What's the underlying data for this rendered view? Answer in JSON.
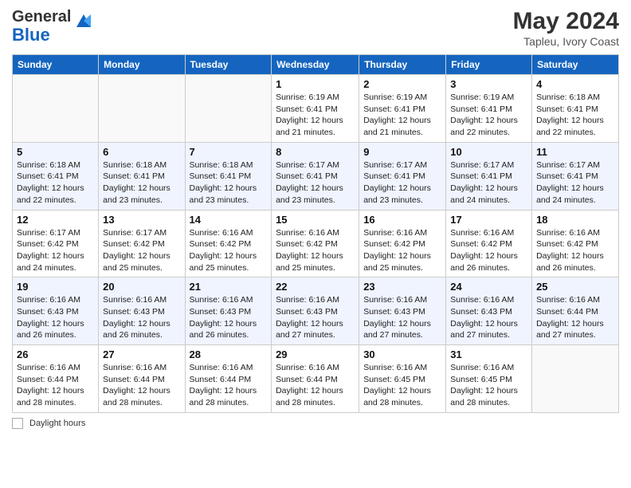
{
  "header": {
    "logo_general": "General",
    "logo_blue": "Blue",
    "month_year": "May 2024",
    "location": "Tapleu, Ivory Coast"
  },
  "weekdays": [
    "Sunday",
    "Monday",
    "Tuesday",
    "Wednesday",
    "Thursday",
    "Friday",
    "Saturday"
  ],
  "weeks": [
    [
      {
        "day": "",
        "info": ""
      },
      {
        "day": "",
        "info": ""
      },
      {
        "day": "",
        "info": ""
      },
      {
        "day": "1",
        "info": "Sunrise: 6:19 AM\nSunset: 6:41 PM\nDaylight: 12 hours and 21 minutes."
      },
      {
        "day": "2",
        "info": "Sunrise: 6:19 AM\nSunset: 6:41 PM\nDaylight: 12 hours and 21 minutes."
      },
      {
        "day": "3",
        "info": "Sunrise: 6:19 AM\nSunset: 6:41 PM\nDaylight: 12 hours and 22 minutes."
      },
      {
        "day": "4",
        "info": "Sunrise: 6:18 AM\nSunset: 6:41 PM\nDaylight: 12 hours and 22 minutes."
      }
    ],
    [
      {
        "day": "5",
        "info": "Sunrise: 6:18 AM\nSunset: 6:41 PM\nDaylight: 12 hours and 22 minutes."
      },
      {
        "day": "6",
        "info": "Sunrise: 6:18 AM\nSunset: 6:41 PM\nDaylight: 12 hours and 23 minutes."
      },
      {
        "day": "7",
        "info": "Sunrise: 6:18 AM\nSunset: 6:41 PM\nDaylight: 12 hours and 23 minutes."
      },
      {
        "day": "8",
        "info": "Sunrise: 6:17 AM\nSunset: 6:41 PM\nDaylight: 12 hours and 23 minutes."
      },
      {
        "day": "9",
        "info": "Sunrise: 6:17 AM\nSunset: 6:41 PM\nDaylight: 12 hours and 23 minutes."
      },
      {
        "day": "10",
        "info": "Sunrise: 6:17 AM\nSunset: 6:41 PM\nDaylight: 12 hours and 24 minutes."
      },
      {
        "day": "11",
        "info": "Sunrise: 6:17 AM\nSunset: 6:41 PM\nDaylight: 12 hours and 24 minutes."
      }
    ],
    [
      {
        "day": "12",
        "info": "Sunrise: 6:17 AM\nSunset: 6:42 PM\nDaylight: 12 hours and 24 minutes."
      },
      {
        "day": "13",
        "info": "Sunrise: 6:17 AM\nSunset: 6:42 PM\nDaylight: 12 hours and 25 minutes."
      },
      {
        "day": "14",
        "info": "Sunrise: 6:16 AM\nSunset: 6:42 PM\nDaylight: 12 hours and 25 minutes."
      },
      {
        "day": "15",
        "info": "Sunrise: 6:16 AM\nSunset: 6:42 PM\nDaylight: 12 hours and 25 minutes."
      },
      {
        "day": "16",
        "info": "Sunrise: 6:16 AM\nSunset: 6:42 PM\nDaylight: 12 hours and 25 minutes."
      },
      {
        "day": "17",
        "info": "Sunrise: 6:16 AM\nSunset: 6:42 PM\nDaylight: 12 hours and 26 minutes."
      },
      {
        "day": "18",
        "info": "Sunrise: 6:16 AM\nSunset: 6:42 PM\nDaylight: 12 hours and 26 minutes."
      }
    ],
    [
      {
        "day": "19",
        "info": "Sunrise: 6:16 AM\nSunset: 6:43 PM\nDaylight: 12 hours and 26 minutes."
      },
      {
        "day": "20",
        "info": "Sunrise: 6:16 AM\nSunset: 6:43 PM\nDaylight: 12 hours and 26 minutes."
      },
      {
        "day": "21",
        "info": "Sunrise: 6:16 AM\nSunset: 6:43 PM\nDaylight: 12 hours and 26 minutes."
      },
      {
        "day": "22",
        "info": "Sunrise: 6:16 AM\nSunset: 6:43 PM\nDaylight: 12 hours and 27 minutes."
      },
      {
        "day": "23",
        "info": "Sunrise: 6:16 AM\nSunset: 6:43 PM\nDaylight: 12 hours and 27 minutes."
      },
      {
        "day": "24",
        "info": "Sunrise: 6:16 AM\nSunset: 6:43 PM\nDaylight: 12 hours and 27 minutes."
      },
      {
        "day": "25",
        "info": "Sunrise: 6:16 AM\nSunset: 6:44 PM\nDaylight: 12 hours and 27 minutes."
      }
    ],
    [
      {
        "day": "26",
        "info": "Sunrise: 6:16 AM\nSunset: 6:44 PM\nDaylight: 12 hours and 28 minutes."
      },
      {
        "day": "27",
        "info": "Sunrise: 6:16 AM\nSunset: 6:44 PM\nDaylight: 12 hours and 28 minutes."
      },
      {
        "day": "28",
        "info": "Sunrise: 6:16 AM\nSunset: 6:44 PM\nDaylight: 12 hours and 28 minutes."
      },
      {
        "day": "29",
        "info": "Sunrise: 6:16 AM\nSunset: 6:44 PM\nDaylight: 12 hours and 28 minutes."
      },
      {
        "day": "30",
        "info": "Sunrise: 6:16 AM\nSunset: 6:45 PM\nDaylight: 12 hours and 28 minutes."
      },
      {
        "day": "31",
        "info": "Sunrise: 6:16 AM\nSunset: 6:45 PM\nDaylight: 12 hours and 28 minutes."
      },
      {
        "day": "",
        "info": ""
      }
    ]
  ],
  "footer": {
    "note_label": "Daylight hours"
  }
}
